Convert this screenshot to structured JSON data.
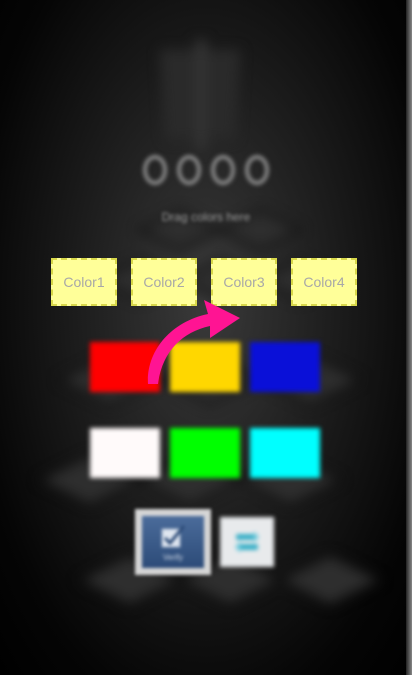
{
  "screen": {
    "instruction": "Drag colors here"
  },
  "pin": {
    "digit_count": 4
  },
  "slots": [
    {
      "label": "Color1"
    },
    {
      "label": "Color2"
    },
    {
      "label": "Color3"
    },
    {
      "label": "Color4"
    }
  ],
  "palette": [
    {
      "name": "red",
      "color": "#ff0000"
    },
    {
      "name": "yellow",
      "color": "#ffd700"
    },
    {
      "name": "blue",
      "color": "#0a10d8"
    },
    {
      "name": "white",
      "color": "#fffafa"
    },
    {
      "name": "green",
      "color": "#00ff00"
    },
    {
      "name": "cyan",
      "color": "#00ffff"
    }
  ],
  "buttons": {
    "ok_label": "Verify",
    "ok_icon": "checkbox-icon",
    "switch_icon": "switch-icon"
  },
  "colors": {
    "slot_bg": "#ffff99",
    "arrow": "#ff1493"
  }
}
